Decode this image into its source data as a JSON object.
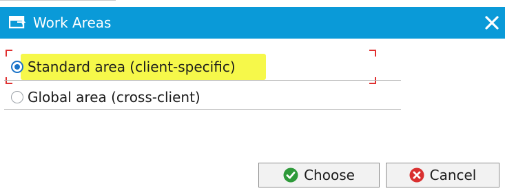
{
  "dialog": {
    "title": "Work Areas",
    "title_icon": "work-areas-icon",
    "close_icon": "close-icon",
    "title_bar_color": "#0a9ad8"
  },
  "options": [
    {
      "label": "Standard area (client-specific)",
      "selected": true
    },
    {
      "label": "Global area (cross-client)",
      "selected": false
    }
  ],
  "highlight_color": "#f6f84a",
  "focus_color": "#e03030",
  "buttons": {
    "choose": {
      "label": "Choose",
      "icon": "checkmark-icon",
      "icon_color": "#2e9a3a"
    },
    "cancel": {
      "label": "Cancel",
      "icon": "cancel-icon",
      "icon_color": "#d93030"
    }
  }
}
